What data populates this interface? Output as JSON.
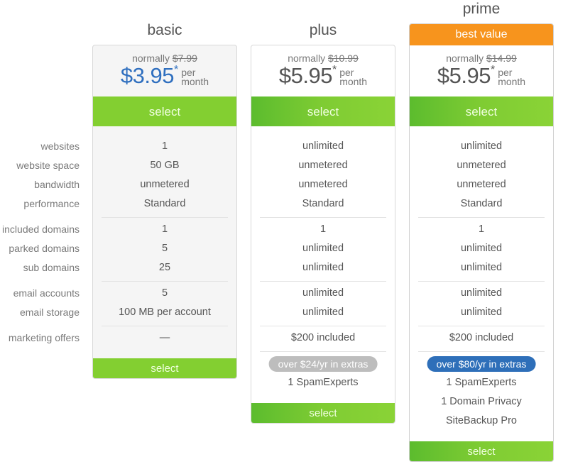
{
  "feature_labels": [
    "websites",
    "website space",
    "bandwidth",
    "performance",
    "included domains",
    "parked domains",
    "sub domains",
    "email accounts",
    "email storage",
    "marketing offers"
  ],
  "plans": [
    {
      "name": "basic",
      "normally_prefix": "normally",
      "normal_price": "$7.99",
      "price": "$3.95",
      "asterisk": "*",
      "per": "per",
      "month": "month",
      "select_label": "select",
      "features": [
        "1",
        "50 GB",
        "unmetered",
        "Standard",
        "1",
        "5",
        "25",
        "5",
        "100 MB per account",
        "—"
      ],
      "bottom_select_label": "select"
    },
    {
      "name": "plus",
      "normally_prefix": "normally",
      "normal_price": "$10.99",
      "price": "$5.95",
      "asterisk": "*",
      "per": "per",
      "month": "month",
      "select_label": "select",
      "features": [
        "unlimited",
        "unmetered",
        "unmetered",
        "Standard",
        "1",
        "unlimited",
        "unlimited",
        "unlimited",
        "unlimited",
        "$200 included"
      ],
      "extras_badge": "over $24/yr in extras",
      "extras": [
        "1 SpamExperts"
      ],
      "bottom_select_label": "select"
    },
    {
      "name": "prime",
      "badge": "best value",
      "normally_prefix": "normally",
      "normal_price": "$14.99",
      "price": "$5.95",
      "asterisk": "*",
      "per": "per",
      "month": "month",
      "select_label": "select",
      "features": [
        "unlimited",
        "unmetered",
        "unmetered",
        "Standard",
        "1",
        "unlimited",
        "unlimited",
        "unlimited",
        "unlimited",
        "$200 included"
      ],
      "extras_badge": "over $80/yr in extras",
      "extras": [
        "1 SpamExperts",
        "1 Domain Privacy",
        "SiteBackup Pro"
      ],
      "bottom_select_label": "select"
    }
  ],
  "colors": {
    "select_green": "#83cf31",
    "best_value_orange": "#f7941d",
    "basic_price_blue": "#2f6fbf",
    "extras_grey": "#bdbdbd",
    "extras_blue": "#2e6fb9"
  }
}
